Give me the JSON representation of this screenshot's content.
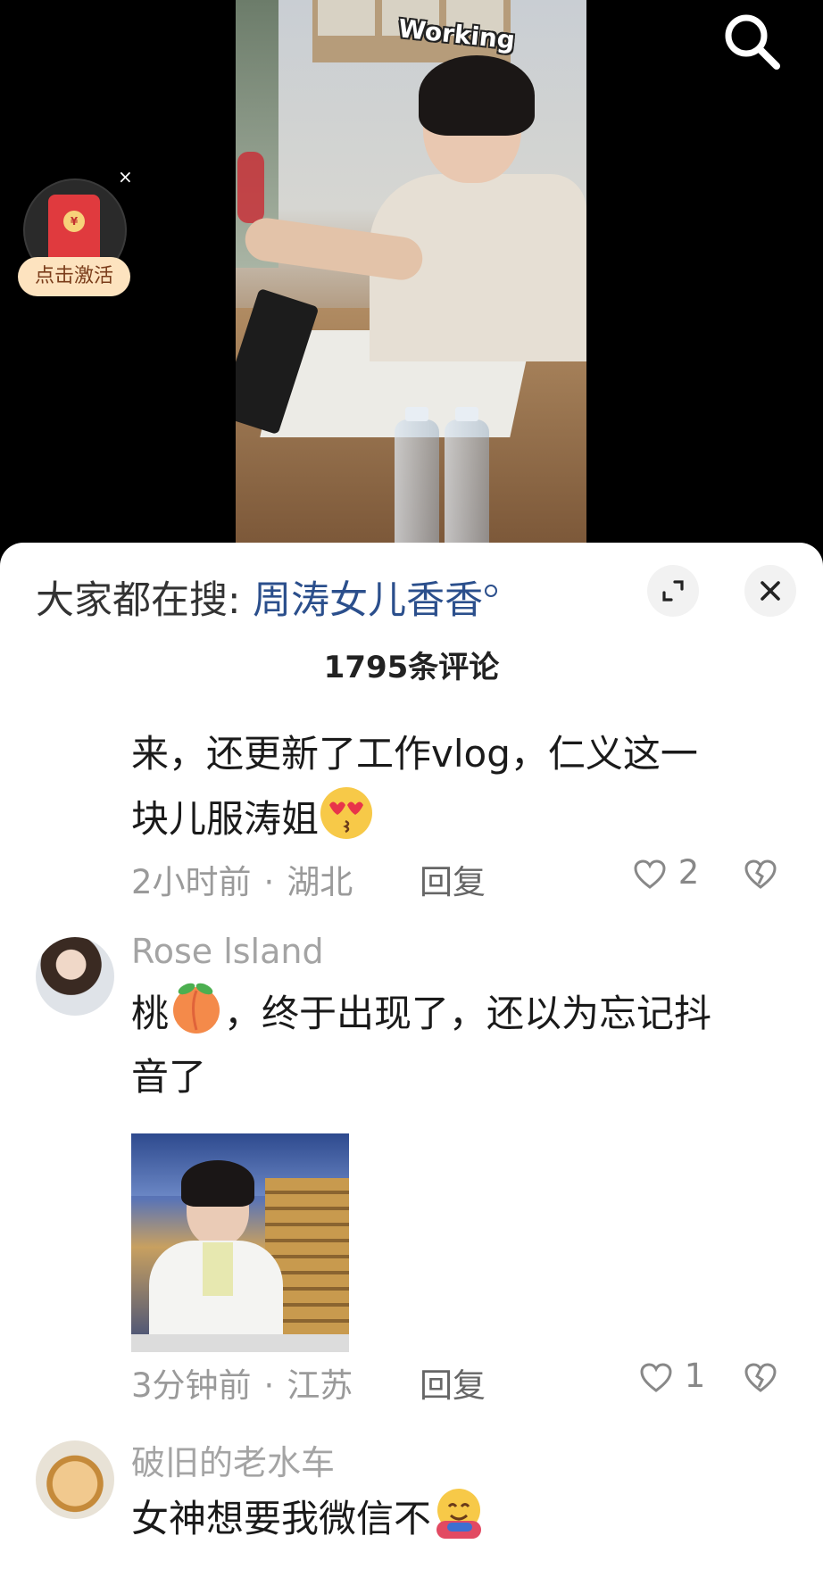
{
  "video": {
    "sticker_text": "Working"
  },
  "red_packet": {
    "label": "点击激活",
    "close_glyph": "×",
    "seal_glyph": "¥"
  },
  "sheet": {
    "hot_search_prefix": "大家都在搜:",
    "hot_search_term": "周涛女儿香香",
    "comment_count": "1795条评论",
    "close_glyph": "×"
  },
  "comments": [
    {
      "line1": "来，还更新了工作vlog，仁义这一",
      "line2": "块儿服涛姐",
      "emoji": "heart-eyes-kiss-emoji",
      "time": "2小时前",
      "location": "湖北",
      "reply": "回复",
      "likes": "2"
    },
    {
      "username": "Rose  lsland",
      "line1_a": "桃",
      "line1_b": "，终于出现了，还以为忘记抖",
      "line2": "音了",
      "emoji": "peach-emoji",
      "time": "3分钟前",
      "location": "江苏",
      "reply": "回复",
      "likes": "1"
    },
    {
      "username": "破旧的老水车",
      "line1": "女神想要我微信不",
      "emoji": "hugging-emoji"
    }
  ],
  "colors": {
    "search_term": "#2b4f8c",
    "meta_gray": "#9a9a9a",
    "red_packet": "#e03a3e"
  }
}
